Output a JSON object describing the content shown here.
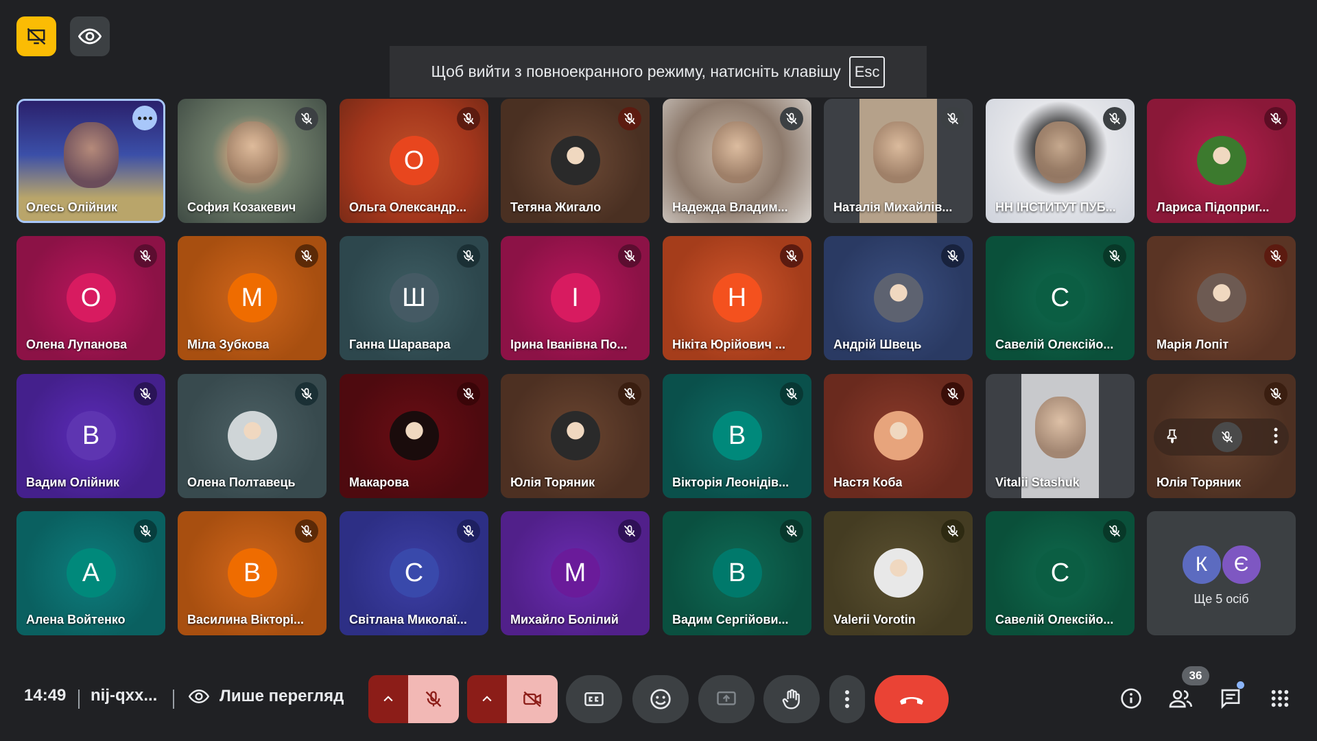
{
  "toast": {
    "message": "Щоб вийти з повноекранного режиму, натисніть клавішу",
    "key": "Esc"
  },
  "tiles": [
    {
      "name": "Олесь Олійник",
      "type": "video"
    },
    {
      "name": "София Козакевич",
      "type": "video"
    },
    {
      "name": "Ольга Олександр...",
      "type": "letter",
      "letter": "О"
    },
    {
      "name": "Тетяна Жигало",
      "type": "photo"
    },
    {
      "name": "Надежда Владим...",
      "type": "video"
    },
    {
      "name": "Наталія Михайлів...",
      "type": "video"
    },
    {
      "name": "НН ІНСТИТУТ ПУБ...",
      "type": "video"
    },
    {
      "name": "Лариса Підоприг...",
      "type": "photo"
    },
    {
      "name": "Олена Лупанова",
      "type": "letter",
      "letter": "О"
    },
    {
      "name": "Міла Зубкова",
      "type": "letter",
      "letter": "М"
    },
    {
      "name": "Ганна Шаравара",
      "type": "letter",
      "letter": "Ш"
    },
    {
      "name": "Ірина Іванівна По...",
      "type": "letter",
      "letter": "І"
    },
    {
      "name": "Нікіта Юрійович ...",
      "type": "letter",
      "letter": "Н"
    },
    {
      "name": "Андрій Швець",
      "type": "photo"
    },
    {
      "name": "Савелій Олексійо...",
      "type": "letter",
      "letter": "С"
    },
    {
      "name": "Марія Лопіт",
      "type": "photo"
    },
    {
      "name": "Вадим Олійник",
      "type": "letter",
      "letter": "В"
    },
    {
      "name": "Олена Полтавець",
      "type": "photo"
    },
    {
      "name": "Макарова",
      "type": "photo"
    },
    {
      "name": "Юлія Торяник",
      "type": "photo"
    },
    {
      "name": "Вікторія Леонідів...",
      "type": "letter",
      "letter": "В"
    },
    {
      "name": "Настя Коба",
      "type": "photo"
    },
    {
      "name": "Vitalii Stashuk",
      "type": "video"
    },
    {
      "name": "Юлія Торяник",
      "type": "hover"
    },
    {
      "name": "Алена Войтенко",
      "type": "letter",
      "letter": "А"
    },
    {
      "name": "Василина Вікторі...",
      "type": "letter",
      "letter": "В"
    },
    {
      "name": "Світлана Миколаї...",
      "type": "letter",
      "letter": "С"
    },
    {
      "name": "Михайло Болілий",
      "type": "letter",
      "letter": "М"
    },
    {
      "name": "Вадим Сергійови...",
      "type": "letter",
      "letter": "В"
    },
    {
      "name": "Valerii Vorotin",
      "type": "photo"
    },
    {
      "name": "Савелій Олексійо...",
      "type": "letter",
      "letter": "С"
    }
  ],
  "others": {
    "label": "Ще 5 осіб",
    "letters": [
      "К",
      "Є"
    ]
  },
  "bottom": {
    "time": "14:49",
    "meeting_code": "nij-qxx...",
    "view_only_label": "Лише перегляд",
    "participants_count": "36"
  },
  "colors": {
    "accent_yellow": "#fbbc04",
    "end_call": "#ea4335",
    "self_outline": "#a8c7fa"
  }
}
